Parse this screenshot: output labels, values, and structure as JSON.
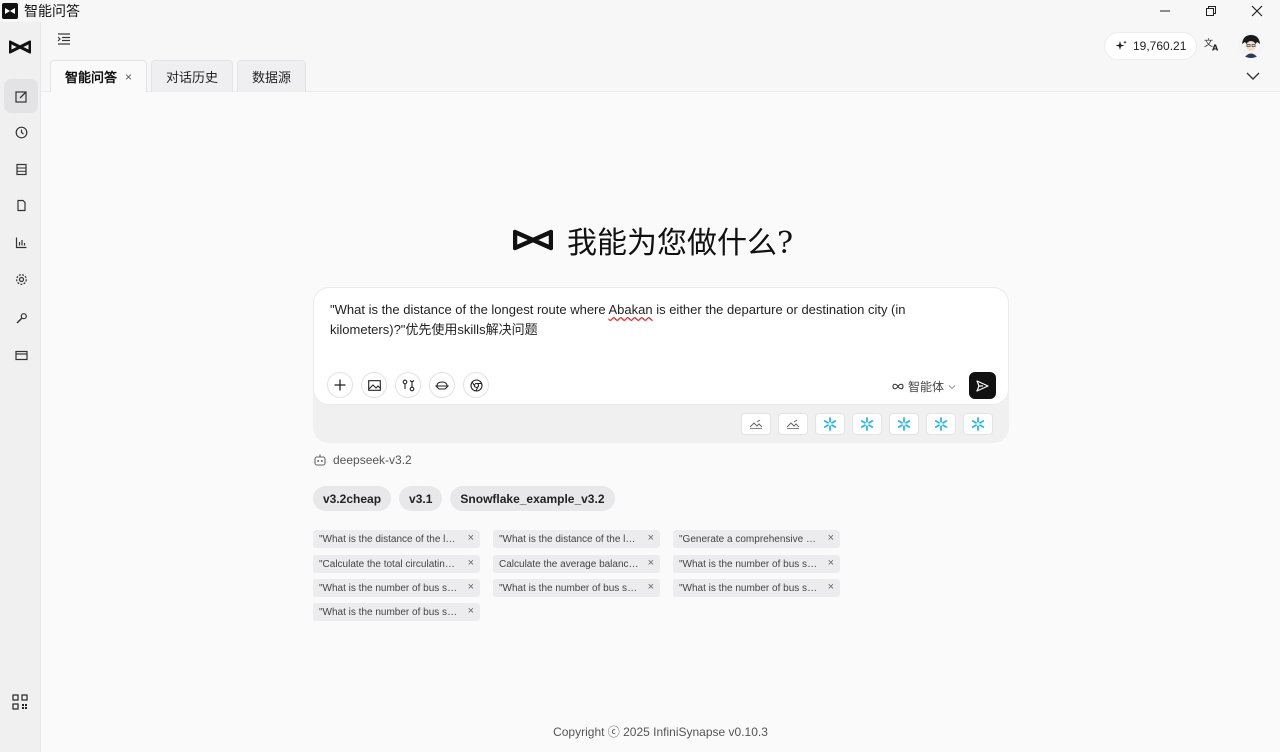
{
  "window": {
    "title": "智能问答"
  },
  "tabs": [
    {
      "label": "智能问答",
      "close": "×"
    },
    {
      "label": "对话历史"
    },
    {
      "label": "数据源"
    }
  ],
  "header": {
    "credits": "19,760.21"
  },
  "hero": {
    "title": "我能为您做什么?"
  },
  "input": {
    "text_before": "\"What is the distance of the longest route where ",
    "text_flagged": "Abakan",
    "text_after": " is either the departure or destination city (in kilometers)?\"优先使用skills解决问题",
    "agent_label": "智能体"
  },
  "model": {
    "name": "deepseek-v3.2"
  },
  "model_chips": [
    "v3.2cheap",
    "v3.1",
    "Snowflake_example_v3.2"
  ],
  "history": [
    "\"What is the distance of the longest route where Abakan",
    "\"What is the distance of the longest route",
    "\"Generate a comprehensive report",
    "\"Calculate the total circulating supply",
    "Calculate the average balance of accounts",
    "\"What is the number of bus stops",
    "\"What is the number of bus stations",
    "\"What is the number of bus stops in",
    "\"What is the number of bus stops near",
    "\"What is the number of bus stops per"
  ],
  "history_close": "×",
  "footer": {
    "copyright": "Copyright ⓒ 2025 InfiniSynapse v0.10.3"
  },
  "colors": {
    "accent": "#111111",
    "snowflake": "#29b5e8"
  }
}
